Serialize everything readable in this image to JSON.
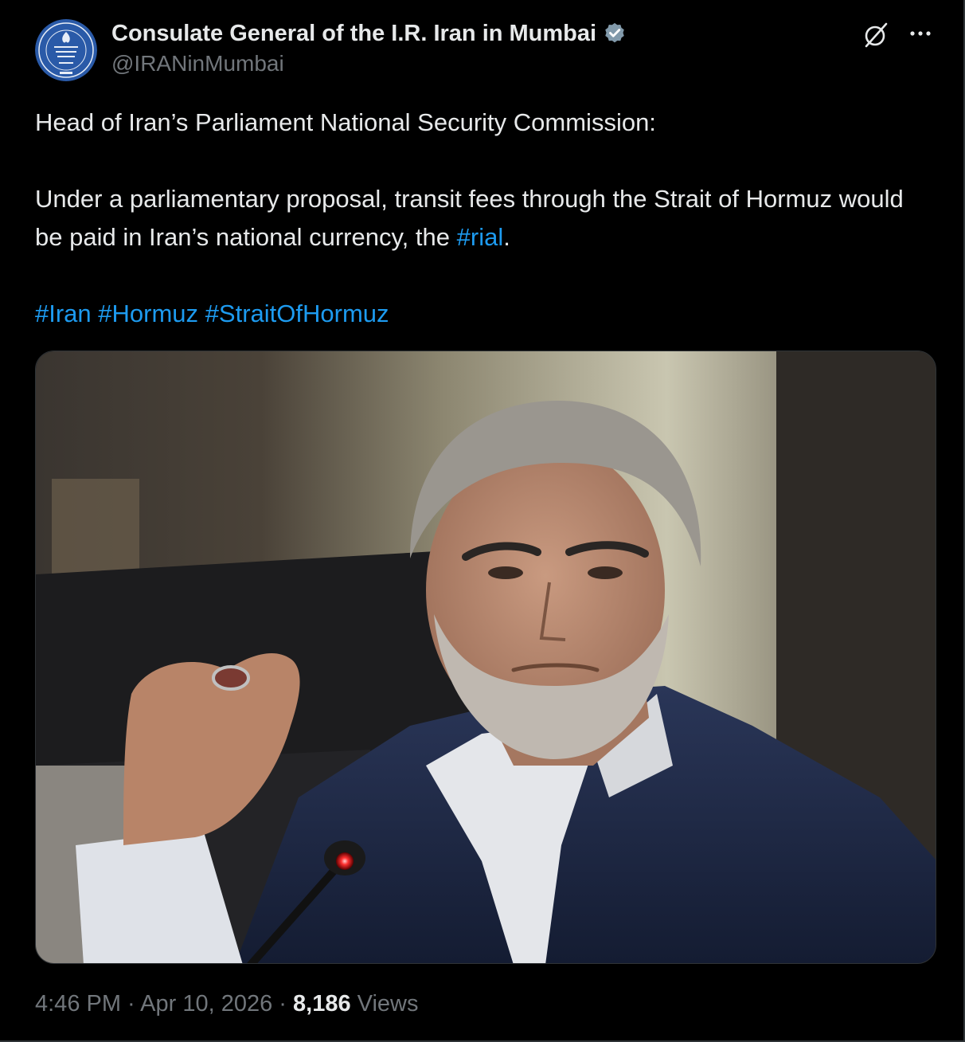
{
  "author": {
    "display_name": "Consulate General of the I.R. Iran in Mumbai",
    "handle": "@IRANinMumbai",
    "avatar_icon": "consulate-emblem",
    "verified_icon": "verified-badge-icon"
  },
  "tweet": {
    "line1": "Head of Iran’s Parliament National Security Commission:",
    "line2_prefix": "Under a parliamentary proposal, transit fees through the Strait of Hormuz would be paid in Iran’s national currency, the ",
    "line2_hashtag": "#rial",
    "line2_suffix": ".",
    "hashtags": [
      "#Iran",
      "#Hormuz",
      "#StraitOfHormuz"
    ]
  },
  "footer": {
    "time": "4:46 PM",
    "separator": " · ",
    "date": "Apr 10, 2026",
    "views_count": "8,186",
    "views_label": "Views"
  },
  "icons": {
    "grok": "grok-icon",
    "more": "more-dots-icon"
  },
  "colors": {
    "background": "#000000",
    "text": "#e7e9ea",
    "secondary": "#71767b",
    "link": "#1d9bf0",
    "verified": "#829aab"
  }
}
